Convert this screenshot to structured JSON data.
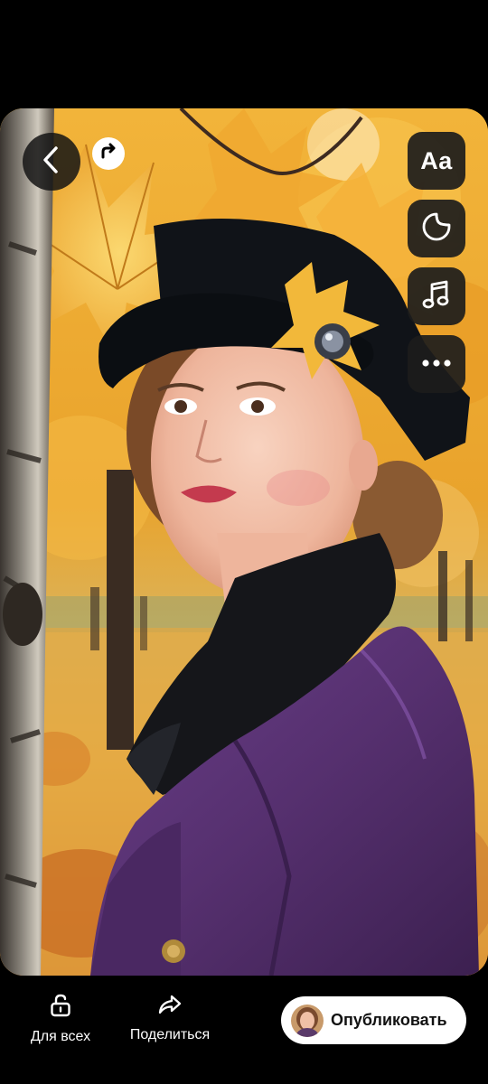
{
  "editor": {
    "photo_description_icon": "autumn-portrait-image",
    "top_left": {
      "back_icon": "chevron-left-icon",
      "repost_icon": "repost-arrow-icon"
    },
    "tools": {
      "text_label": "Aa",
      "sticker_icon": "sticker-icon",
      "music_icon": "music-note-icon",
      "more_icon": "more-horizontal-icon"
    }
  },
  "bottom_bar": {
    "privacy": {
      "label": "Для всех",
      "icon": "unlock-icon"
    },
    "share": {
      "label": "Поделиться",
      "icon": "share-arrow-icon"
    },
    "publish": {
      "label": "Опубликовать",
      "avatar_icon": "user-avatar"
    }
  },
  "colors": {
    "background": "#000000",
    "tool_bg": "#1c1c1c",
    "publish_bg": "#ffffff",
    "text_light": "#ffffff",
    "text_dark": "#111111"
  }
}
